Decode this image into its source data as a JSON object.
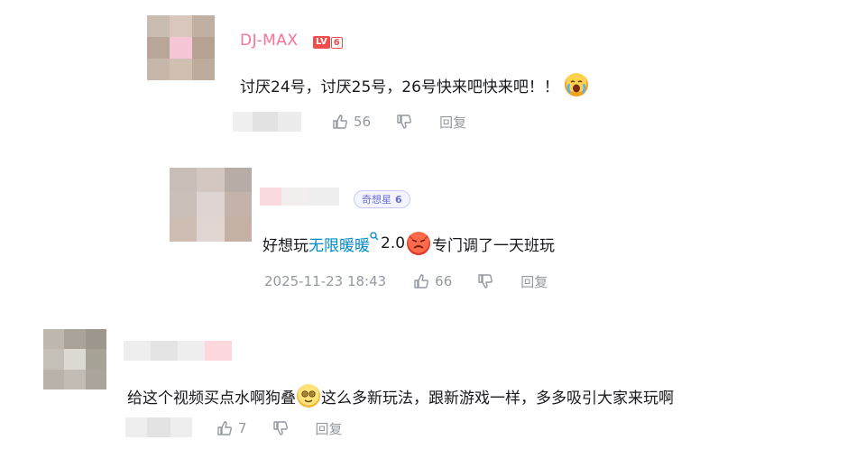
{
  "comments": [
    {
      "user": {
        "name": "DJ-MAX",
        "level_prefix": "LV",
        "level": "6"
      },
      "text": "讨厌24号，讨厌25号，26号快来吧快来吧！！",
      "emoji": "crying-emoji",
      "likes": "56",
      "reply_label": "回复"
    },
    {
      "user": {
        "fan_badge_label": "奇想星",
        "fan_badge_level": "6"
      },
      "text_before": "好想玩 ",
      "link_text": "无限暖暖",
      "text_after_link": "2.0",
      "text_end": "专门调了一天班玩",
      "emoji": "angry-emoji",
      "time": "2025-11-23 18:43",
      "likes": "66",
      "reply_label": "回复"
    },
    {
      "text_before": "给这个视频买点水啊狗叠",
      "text_after": "这么多新玩法，跟新游戏一样，多多吸引大家来玩啊",
      "emoji": "dizzy-emoji",
      "likes": "7",
      "reply_label": "回复"
    }
  ],
  "icons": {
    "like": "thumbs-up-icon",
    "dislike": "thumbs-down-icon",
    "search": "search-icon"
  },
  "colors": {
    "username": "#fb7299",
    "link": "#008ac5",
    "meta": "#9499a0",
    "level_badge": "#f04d4d"
  }
}
